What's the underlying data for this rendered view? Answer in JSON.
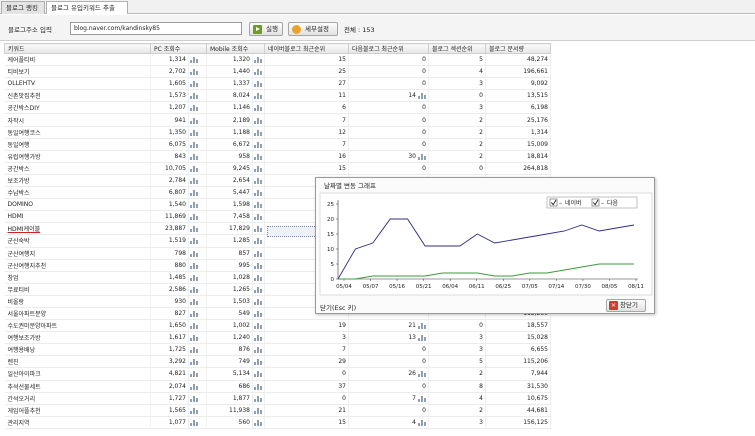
{
  "tabs": [
    "블로그 랭킹",
    "블로그 유입키워드 추출"
  ],
  "toolbar": {
    "label": "블로그주소 입력",
    "url_value": "blog.naver.com/kandinsky85",
    "run_label": "실행",
    "settings_label": "세부설정",
    "total_text": "전체 : 153"
  },
  "table": {
    "columns": [
      "키워드",
      "PC 조회수",
      "Mobile 조회수",
      "네이버블로그 최근순위",
      "다음블로그 최근순위",
      "블로그 섹션순위",
      "블로그 문서량"
    ],
    "rows": [
      [
        "케어플티비",
        "1,314",
        "1,320",
        "15",
        "0",
        "5",
        "48,274"
      ],
      [
        "티비보기",
        "2,702",
        "1,440",
        "25",
        "0",
        "4",
        "196,661"
      ],
      [
        "OLLEHTV",
        "1,605",
        "1,337",
        "27",
        "0",
        "3",
        "9,092"
      ],
      [
        "신촌맛집추천",
        "1,573",
        "8,024",
        "11",
        "14",
        "0",
        "13,515"
      ],
      [
        "공간박스DIY",
        "1,207",
        "1,146",
        "6",
        "0",
        "3",
        "6,198"
      ],
      [
        "자작시",
        "941",
        "2,189",
        "7",
        "0",
        "2",
        "25,176"
      ],
      [
        "동일여행코스",
        "1,350",
        "1,188",
        "12",
        "0",
        "2",
        "1,314"
      ],
      [
        "동일여행",
        "6,075",
        "6,672",
        "7",
        "0",
        "2",
        "15,009"
      ],
      [
        "유럽여행가방",
        "843",
        "958",
        "16",
        "30",
        "2",
        "18,814"
      ],
      [
        "공간박스",
        "10,705",
        "9,245",
        "15",
        "0",
        "0",
        "264,818"
      ],
      [
        "보조가방",
        "2,784",
        "2,654",
        "",
        "",
        "",
        ""
      ],
      [
        "수납박스",
        "6,807",
        "5,447",
        "",
        "",
        "",
        ""
      ],
      [
        "DOMINO",
        "1,540",
        "1,598",
        "",
        "",
        "",
        ""
      ],
      [
        "HDMI",
        "11,869",
        "7,458",
        "",
        "",
        "",
        ""
      ],
      [
        "HDMI케이블",
        "23,887",
        "17,829",
        "",
        "",
        "",
        ""
      ],
      [
        "군산숙박",
        "1,519",
        "1,285",
        "",
        "",
        "",
        ""
      ],
      [
        "군산여행지",
        "798",
        "857",
        "",
        "",
        "",
        ""
      ],
      [
        "군산여행지추천",
        "880",
        "995",
        "",
        "",
        "",
        ""
      ],
      [
        "창업",
        "1,485",
        "1,028",
        "",
        "",
        "",
        ""
      ],
      [
        "무료티비",
        "2,586",
        "1,265",
        "",
        "",
        "",
        ""
      ],
      [
        "비올랑",
        "930",
        "1,503",
        "",
        "",
        "",
        ""
      ],
      [
        "서울아파트분양",
        "827",
        "549",
        "",
        "",
        "",
        "112,230"
      ],
      [
        "수도권미분양아파트",
        "1,650",
        "1,002",
        "19",
        "21",
        "0",
        "18,557"
      ],
      [
        "여행보조가방",
        "1,617",
        "1,240",
        "3",
        "13",
        "3",
        "15,028"
      ],
      [
        "여행용배낭",
        "1,725",
        "876",
        "7",
        "0",
        "3",
        "6,655"
      ],
      [
        "렌진",
        "3,292",
        "749",
        "29",
        "0",
        "5",
        "115,206"
      ],
      [
        "일산아이파크",
        "4,821",
        "5,134",
        "0",
        "26",
        "2",
        "7,944"
      ],
      [
        "추석선물세트",
        "2,074",
        "686",
        "37",
        "0",
        "8",
        "31,530"
      ],
      [
        "간석오거리",
        "1,727",
        "1,877",
        "0",
        "7",
        "4",
        "10,675"
      ],
      [
        "게임어플추천",
        "1,565",
        "11,938",
        "21",
        "0",
        "2",
        "44,681"
      ],
      [
        "관리지역",
        "1,077",
        "560",
        "15",
        "4",
        "3",
        "156,125"
      ]
    ]
  },
  "popup": {
    "title": "날짜별 변동 그래프",
    "status": "닫기(Esc 키)",
    "close_label": "창닫기"
  },
  "chart_data": {
    "type": "line",
    "x": [
      "05/04",
      "05/07",
      "05/16",
      "05/21",
      "06/04",
      "06/11",
      "06/25",
      "07/05",
      "07/14",
      "07/30",
      "08/05",
      "08/11"
    ],
    "series": [
      {
        "name": "네이버",
        "color": "#2b2f84",
        "values": [
          0,
          10,
          12,
          20,
          20,
          11,
          11,
          11,
          15,
          12,
          13,
          14,
          15,
          16,
          18,
          16,
          17,
          18
        ]
      },
      {
        "name": "다음",
        "color": "#3b9a3b",
        "values": [
          0,
          0,
          1,
          1,
          1,
          1,
          2,
          2,
          2,
          1,
          1,
          2,
          2,
          3,
          4,
          5,
          5,
          5
        ]
      }
    ],
    "ylim": [
      0,
      25
    ],
    "yticks": [
      0,
      5,
      10,
      15,
      20,
      25
    ],
    "legend": "top-right",
    "grid": false
  }
}
